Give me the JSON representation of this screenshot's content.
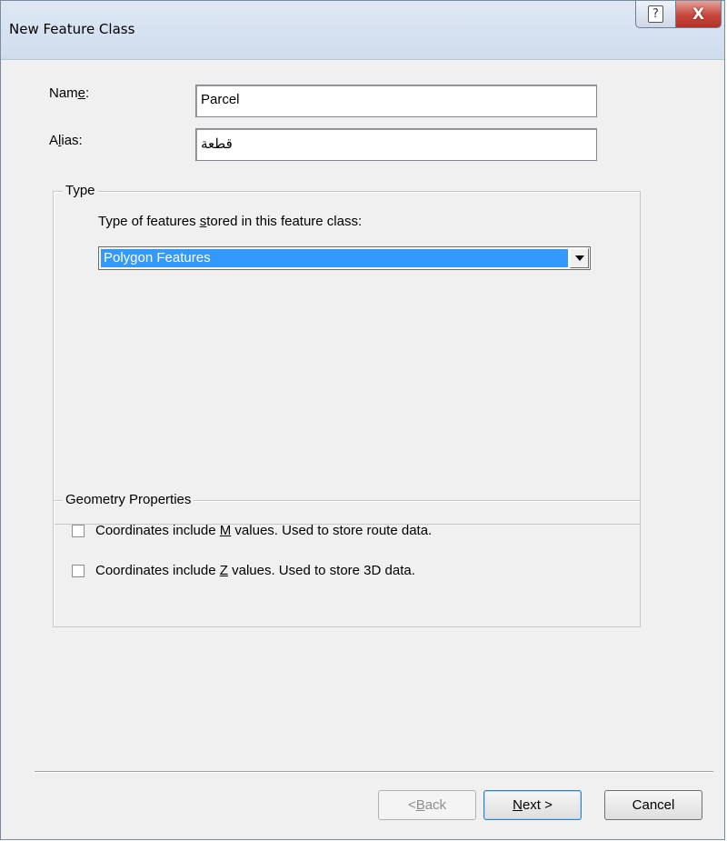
{
  "window": {
    "title": "New Feature Class",
    "help_glyph": "?",
    "close_glyph": "X"
  },
  "form": {
    "name_label_pre": "Nam",
    "name_label_accel": "e",
    "name_label_post": ":",
    "name_value": "Parcel",
    "alias_label_pre": "A",
    "alias_label_accel": "l",
    "alias_label_post": "ias:",
    "alias_value": "قطعة"
  },
  "type_group": {
    "title": "Type",
    "description_pre": "Type of features ",
    "description_accel": "s",
    "description_post": "tored in this feature class:",
    "selected_value": "Polygon Features"
  },
  "geometry_group": {
    "title": "Geometry Properties",
    "m_values": {
      "label_pre": "Coordinates include ",
      "label_accel": "M",
      "label_post": " values. Used to store route data.",
      "checked": false
    },
    "z_values": {
      "label_pre": "Coordinates include ",
      "label_accel": "Z",
      "label_post": " values. Used to store 3D data.",
      "checked": false
    }
  },
  "buttons": {
    "back_pre": "< ",
    "back_accel": "B",
    "back_post": "ack",
    "next_accel": "N",
    "next_post": "ext >",
    "cancel": "Cancel"
  },
  "icons": {
    "help": "help-icon",
    "close": "close-icon",
    "dropdown": "chevron-down-icon"
  }
}
